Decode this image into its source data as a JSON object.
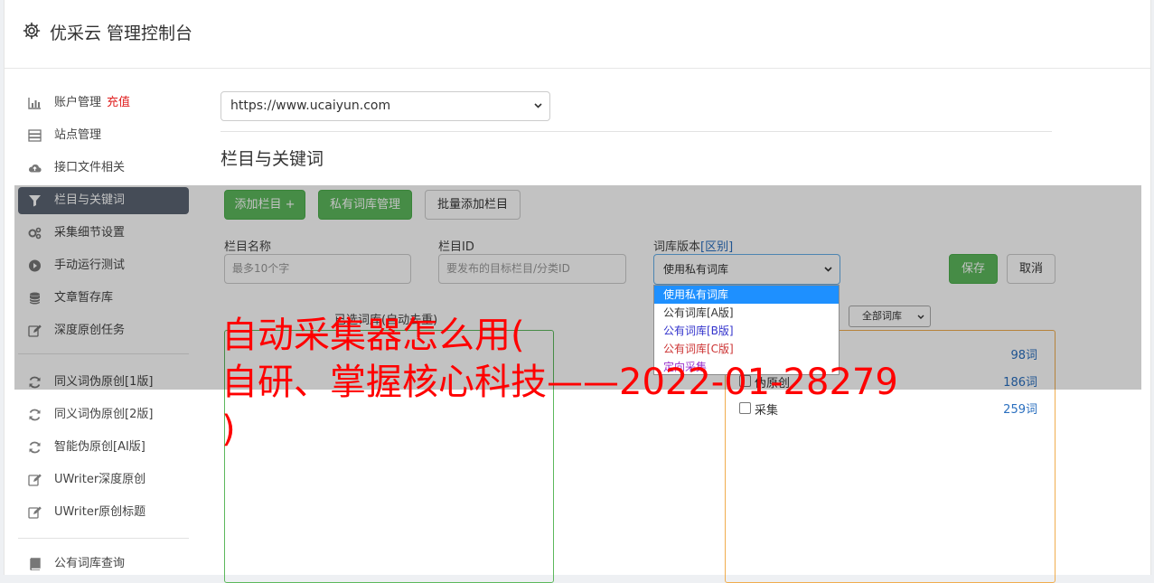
{
  "app": {
    "title": "优采云 管理控制台",
    "icon": "gear-icon"
  },
  "sidebar": {
    "groups": [
      [
        {
          "label": "账户管理",
          "tag": "充值",
          "icon": "bar-chart-icon"
        },
        {
          "label": "站点管理",
          "icon": "server-icon"
        },
        {
          "label": "接口文件相关",
          "icon": "cloud-upload-icon"
        },
        {
          "label": "栏目与关键词",
          "icon": "filter-icon",
          "active": true
        },
        {
          "label": "采集细节设置",
          "icon": "cogs-icon"
        },
        {
          "label": "手动运行测试",
          "icon": "play-icon"
        },
        {
          "label": "文章暂存库",
          "icon": "database-icon"
        },
        {
          "label": "深度原创任务",
          "icon": "edit-icon"
        }
      ],
      [
        {
          "label": "同义词伪原创[1版]",
          "icon": "refresh-icon"
        },
        {
          "label": "同义词伪原创[2版]",
          "icon": "refresh-icon"
        },
        {
          "label": "智能伪原创[AI版]",
          "icon": "refresh-icon"
        },
        {
          "label": "UWriter深度原创",
          "icon": "edit-icon"
        },
        {
          "label": "UWriter原创标题",
          "icon": "edit-icon"
        }
      ],
      [
        {
          "label": "公有词库查询",
          "icon": "book-icon"
        }
      ]
    ]
  },
  "site_select": {
    "value": "https://www.ucaiyun.com"
  },
  "section": {
    "title": "栏目与关键词"
  },
  "toolbar": {
    "add_column": "添加栏目 +",
    "private_lib": "私有词库管理",
    "batch_add": "批量添加栏目"
  },
  "form": {
    "name_label": "栏目名称",
    "name_placeholder": "最多10个字",
    "id_label": "栏目ID",
    "id_placeholder": "要发布的目标栏目/分类ID",
    "version_label": "词库版本",
    "version_link": "[区别]",
    "version_value": "使用私有词库",
    "save": "保存",
    "cancel": "取消"
  },
  "version_options": [
    {
      "label": "使用私有词库",
      "color": "#ffffff",
      "selected": true
    },
    {
      "label": "公有词库[A版]",
      "color": "#333333"
    },
    {
      "label": "公有词库[B版]",
      "color": "#3333cc"
    },
    {
      "label": "公有词库[C版]",
      "color": "#cc3333"
    },
    {
      "label": "定向采集",
      "color": "#9933cc"
    }
  ],
  "selected_panel": {
    "title": "已选词库(自动去重)"
  },
  "library": {
    "filter": "全部词库",
    "items": [
      {
        "name": "",
        "count": "98词"
      },
      {
        "name": "伪原创",
        "count": "186词"
      },
      {
        "name": "采集",
        "count": "259词"
      }
    ]
  },
  "colors": {
    "primary": "#5cb85c",
    "active_nav": "#5b6573",
    "link": "#2a6fbf",
    "watermark": "#ff0000"
  },
  "watermark": {
    "text": "自动采集器怎么用(\n自研、掌握核心科技——2022-01-28279\n)"
  }
}
